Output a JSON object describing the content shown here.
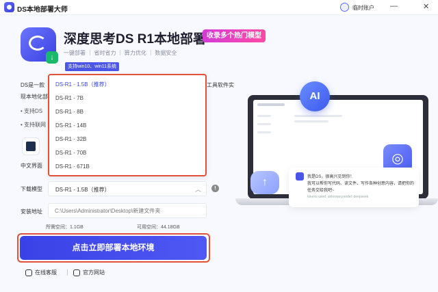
{
  "titlebar": {
    "app_title": "DS本地部署大师",
    "user_label": "临时账户",
    "minimize": "—",
    "close": "✕"
  },
  "hero": {
    "title": "深度思考DS R1本地部署",
    "tag": "收录多个热门模型",
    "features": "一键部署 ｜ 省时省力 ｜ 算力优化 ｜ 数据安全",
    "system_badge": "支持win10、win11系统"
  },
  "intro": {
    "line1": "DS是一款",
    "line1_right": "工具软件实",
    "line2": "现本地化部",
    "bullet1": "• 支持DS",
    "bullet2": "• 支持联网",
    "ui_label": "中文界面"
  },
  "model_dropdown": {
    "options": [
      "DS-R1 - 1.5B（推荐）",
      "DS-R1 - 7B",
      "DS-R1 - 8B",
      "DS-R1 - 14B",
      "DS-R1 - 32B",
      "DS-R1 - 70B",
      "DS-R1 - 671B"
    ],
    "selected_index": 0
  },
  "form": {
    "model_label": "下载模型",
    "model_value": "DS-R1 - 1.5B（推荐）",
    "path_label": "安装地址",
    "path_value": "C:\\Users\\Administrator\\Desktop\\新建文件夹",
    "space_used": "所需空间：1.1GB",
    "space_free": "可用空间：44.18GB"
  },
  "actions": {
    "deploy_label": "点击立即部署本地环境",
    "support_label": "在线客服",
    "website_label": "官方网站"
  },
  "illustration": {
    "ai_label": "AI",
    "chat_line1": "我是DS，很高兴见到你！",
    "chat_line2": "我可以帮你写代码、读文件、写作各种创意内容，请把你的",
    "chat_line3": "任务交给我吧~",
    "chat_foot": "tokens used: unknown,model: deepseek"
  },
  "colors": {
    "accent": "#3a41e6",
    "highlight_border": "#e2503a",
    "tag_gradient_start": "#d43ad6"
  }
}
